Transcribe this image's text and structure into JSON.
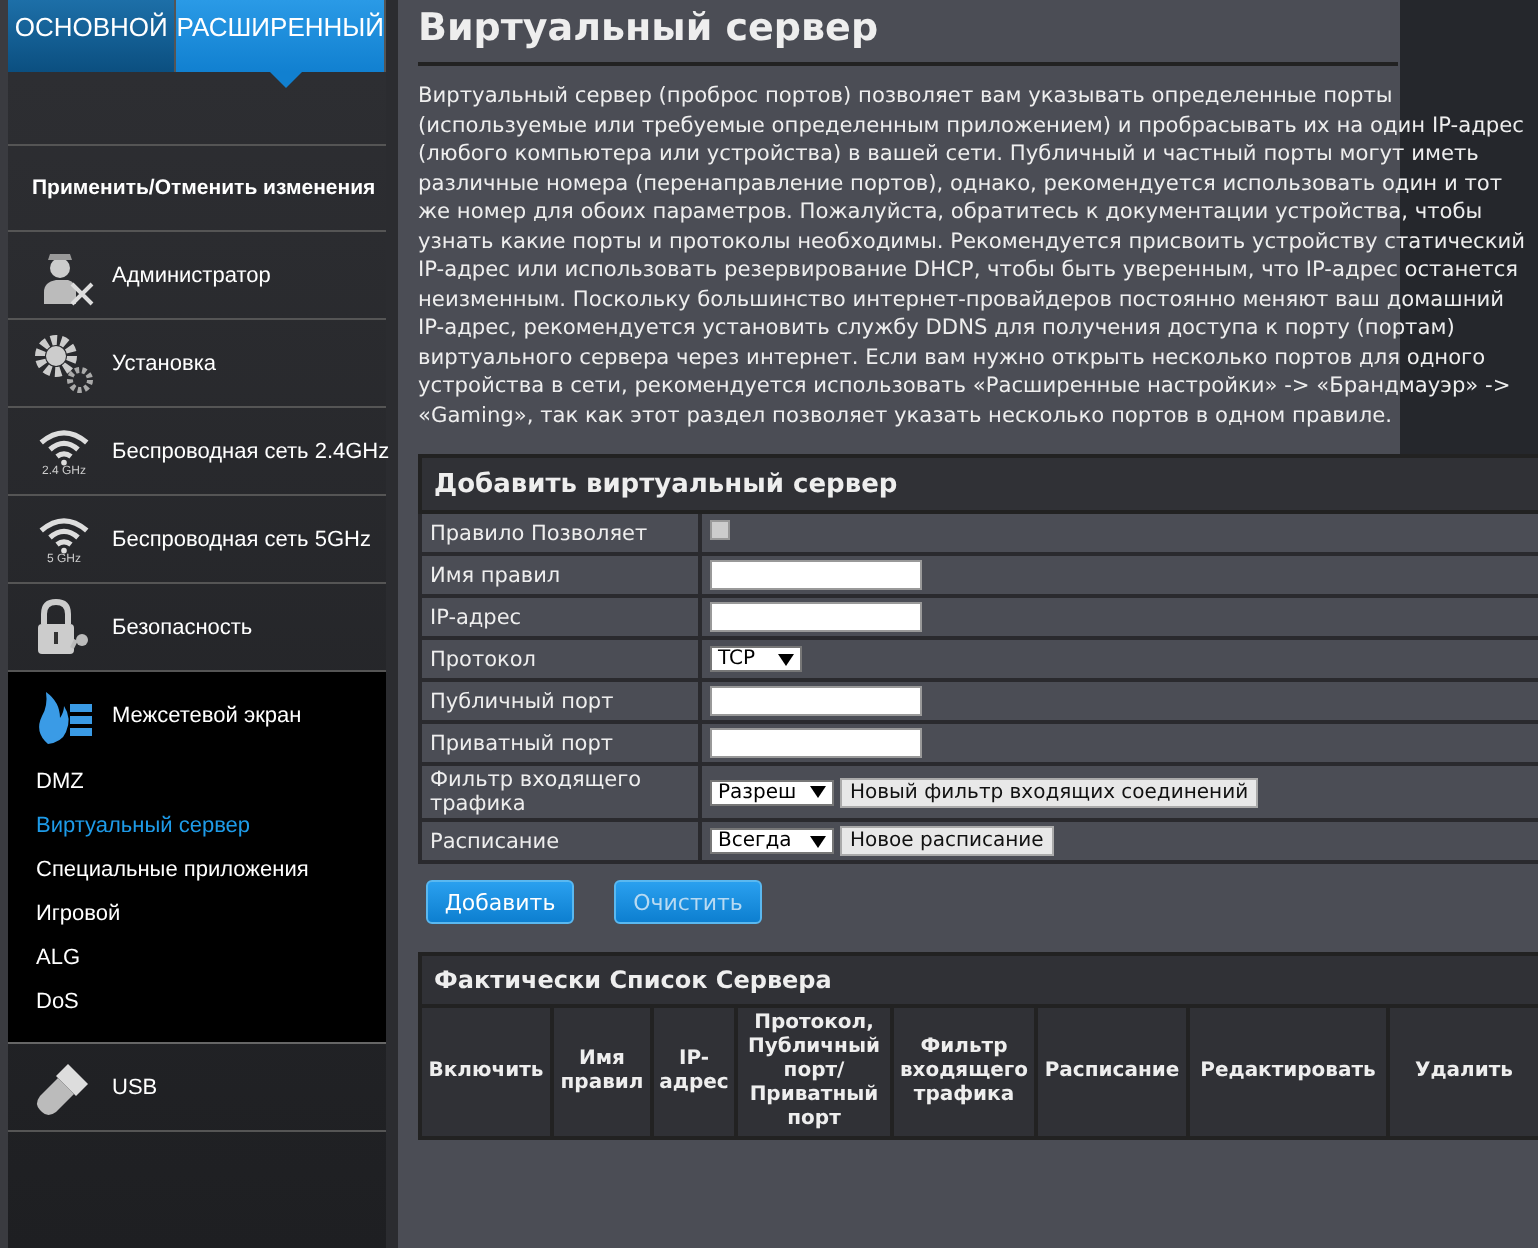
{
  "tabs": [
    {
      "label": "ОСНОВНОЙ",
      "selected": false
    },
    {
      "label": "РАСШИРЕННЫЙ",
      "selected": true
    }
  ],
  "apply_label": "Применить/Отменить изменения",
  "nav": [
    {
      "kind": "admin",
      "label": "Администратор",
      "expanded": false
    },
    {
      "kind": "setup",
      "label": "Установка",
      "expanded": false
    },
    {
      "kind": "wifi",
      "label": "Беспроводная сеть 2.4GHz",
      "band": "2.4 GHz",
      "expanded": false
    },
    {
      "kind": "wifi",
      "label": "Беспроводная сеть 5GHz",
      "band": "5 GHz",
      "expanded": false
    },
    {
      "kind": "security",
      "label": "Безопасность",
      "expanded": false
    },
    {
      "kind": "firewall",
      "label": "Межсетевой экран",
      "expanded": true,
      "children": [
        {
          "label": "DMZ",
          "selected": false
        },
        {
          "label": "Виртуальный сервер",
          "selected": true
        },
        {
          "label": "Специальные приложения",
          "selected": false
        },
        {
          "label": "Игровой",
          "selected": false
        },
        {
          "label": "ALG",
          "selected": false
        },
        {
          "label": "DoS",
          "selected": false
        }
      ]
    },
    {
      "kind": "usb",
      "label": "USB",
      "expanded": false
    }
  ],
  "title": "Виртуальный сервер",
  "description": "Виртуальный сервер (проброс портов) позволяет вам указывать определенные порты (используемые или требуемые определенным приложением) и пробрасывать их на один IP-адрес (любого компьютера или устройства) в вашей сети. Публичный и частный порты могут иметь различные номера (перенаправление портов), однако, рекомендуется использовать один и тот же номер для обоих параметров. Пожалуйста, обратитесь к документации устройства, чтобы узнать какие порты и протоколы необходимы. Рекомендуется присвоить устройству статический IP-адрес или использовать резервирование DHCP, чтобы быть уверенным, что IP-адрес останется неизменным. Поскольку большинство интернет-провайдеров постоянно меняют ваш домашний IP-адрес, рекомендуется установить службу DDNS для получения доступа к порту (портам) виртуального сервера через интернет. Если вам нужно открыть несколько портов для одного устройства в сети, рекомендуется использовать «Расширенные настройки» -> «Брандмауэр» -> «Gaming», так как этот раздел позволяет указать несколько портов в одном правиле.",
  "add_form": {
    "title": "Добавить виртуальный сервер",
    "rows": [
      {
        "kind": "checkbox",
        "label": "Правило Позволяет",
        "checked": false
      },
      {
        "kind": "text",
        "label": "Имя правил"
      },
      {
        "kind": "text",
        "label": "IP-адрес"
      },
      {
        "kind": "select",
        "label": "Протокол",
        "value": "TCP"
      },
      {
        "kind": "text",
        "label": "Публичный порт"
      },
      {
        "kind": "text",
        "label": "Приватный порт"
      },
      {
        "kind": "select_button",
        "label": "Фильтр входящего трафика",
        "value": "Разреш",
        "button": "Новый фильтр входящих соединений"
      },
      {
        "kind": "select_button",
        "label": "Расписание",
        "value": "Всегда",
        "button": "Новое расписание"
      }
    ]
  },
  "buttons": [
    {
      "label": "Добавить",
      "disabled": false
    },
    {
      "label": "Очистить",
      "disabled": true
    }
  ],
  "server_list": {
    "title": "Фактически Список Сервера",
    "columns": [
      "Включить",
      "Имя правил",
      "IP-адрес",
      "Протокол, Публичный порт/ Приватный порт",
      "Фильтр входящего трафика",
      "Расписание",
      "Редактировать",
      "Удалить"
    ]
  }
}
